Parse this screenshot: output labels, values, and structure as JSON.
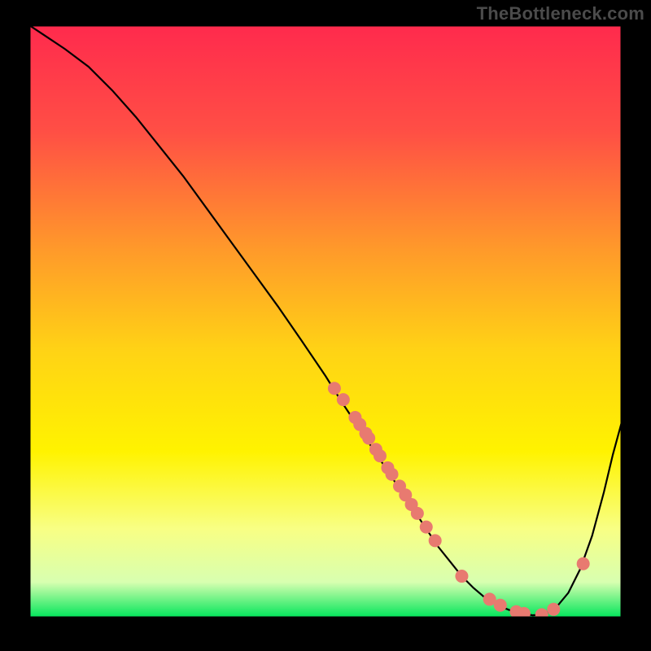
{
  "watermark": "TheBottleneck.com",
  "colors": {
    "gradient_stops": [
      {
        "offset": "0%",
        "color": "#ff2a4d"
      },
      {
        "offset": "18%",
        "color": "#ff4f45"
      },
      {
        "offset": "38%",
        "color": "#ff9a2a"
      },
      {
        "offset": "55%",
        "color": "#ffd315"
      },
      {
        "offset": "72%",
        "color": "#fff300"
      },
      {
        "offset": "85%",
        "color": "#f8ff84"
      },
      {
        "offset": "94%",
        "color": "#d8ffb0"
      },
      {
        "offset": "100%",
        "color": "#00e55a"
      }
    ],
    "curve": "#000000",
    "dots": "#e87a70",
    "dot_radius": 8
  },
  "chart_data": {
    "type": "line",
    "title": "",
    "xlabel": "",
    "ylabel": "",
    "xlim": [
      0,
      100
    ],
    "ylim": [
      0,
      100
    ],
    "x": [
      0,
      3,
      6,
      10,
      14,
      18,
      22,
      26,
      30,
      34,
      38,
      42,
      46,
      50,
      53,
      55,
      57,
      59,
      61,
      63,
      65,
      67,
      69,
      71,
      73,
      75,
      77,
      79,
      81,
      83,
      85,
      87,
      89,
      91,
      93,
      95,
      97,
      98.5,
      100
    ],
    "values": [
      100,
      98,
      96,
      93,
      89,
      84.5,
      79.5,
      74.5,
      69,
      63.5,
      58,
      52.5,
      46.7,
      40.8,
      36,
      33,
      30,
      27,
      24,
      21,
      18,
      15,
      12,
      9.5,
      7,
      5,
      3.3,
      2.1,
      1.3,
      0.7,
      0.4,
      0.6,
      1.8,
      4.2,
      8.2,
      13.8,
      21.2,
      27.5,
      33
    ],
    "dots": [
      {
        "x": 51.5,
        "y": 38.7
      },
      {
        "x": 53.0,
        "y": 36.8
      },
      {
        "x": 55.0,
        "y": 33.8
      },
      {
        "x": 55.8,
        "y": 32.6
      },
      {
        "x": 56.8,
        "y": 31.1
      },
      {
        "x": 57.3,
        "y": 30.3
      },
      {
        "x": 58.5,
        "y": 28.4
      },
      {
        "x": 59.2,
        "y": 27.3
      },
      {
        "x": 60.5,
        "y": 25.3
      },
      {
        "x": 61.2,
        "y": 24.2
      },
      {
        "x": 62.5,
        "y": 22.2
      },
      {
        "x": 63.5,
        "y": 20.7
      },
      {
        "x": 64.5,
        "y": 19.1
      },
      {
        "x": 65.5,
        "y": 17.6
      },
      {
        "x": 67.0,
        "y": 15.3
      },
      {
        "x": 68.5,
        "y": 13.0
      },
      {
        "x": 73.0,
        "y": 7.0
      },
      {
        "x": 77.7,
        "y": 3.1
      },
      {
        "x": 79.5,
        "y": 2.1
      },
      {
        "x": 82.2,
        "y": 1.0
      },
      {
        "x": 83.5,
        "y": 0.7
      },
      {
        "x": 86.5,
        "y": 0.5
      },
      {
        "x": 88.5,
        "y": 1.4
      },
      {
        "x": 93.5,
        "y": 9.1
      }
    ]
  }
}
